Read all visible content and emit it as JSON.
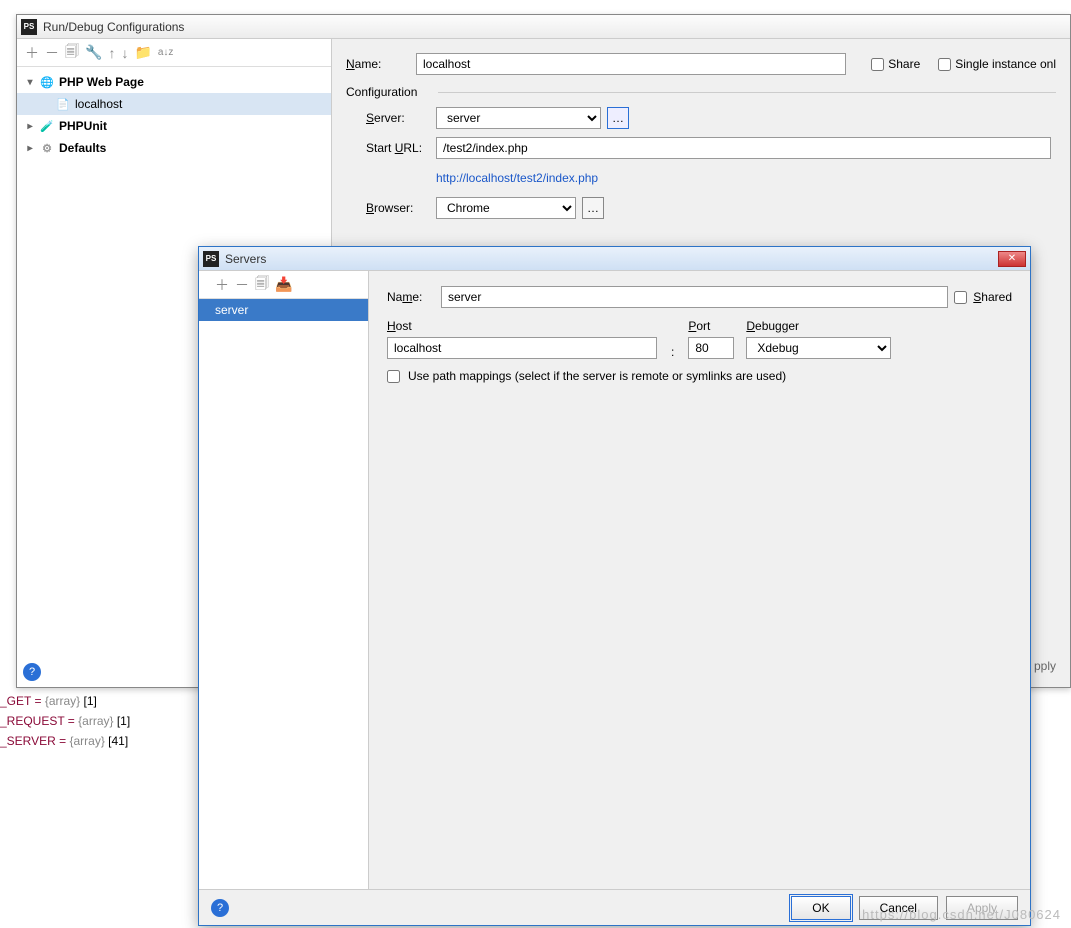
{
  "run": {
    "title": "Run/Debug Configurations",
    "name_label": "Name:",
    "name_value": "localhost",
    "share": "Share",
    "single": "Single instance onl",
    "config_group": "Configuration",
    "server_label": "Server:",
    "server_value": "server",
    "starturl_label": "Start URL:",
    "starturl_value": "/test2/index.php",
    "full_url": "http://localhost/test2/index.php",
    "browser_label": "Browser:",
    "browser_value": "Chrome",
    "tree": {
      "phpweb": "PHP Web Page",
      "localhost": "localhost",
      "phpunit": "PHPUnit",
      "defaults": "Defaults"
    },
    "apply_label": "pply"
  },
  "servers": {
    "title": "Servers",
    "name_label": "Name:",
    "name_value": "server",
    "shared": "Shared",
    "host_label": "Host",
    "host_value": "localhost",
    "port_label": "Port",
    "port_value": "80",
    "debugger_label": "Debugger",
    "debugger_value": "Xdebug",
    "pathmap": "Use path mappings (select if the server is remote or symlinks are used)",
    "list_item": "server",
    "ok": "OK",
    "cancel": "Cancel",
    "apply": "Apply"
  },
  "code": {
    "l1a": "_GET = ",
    "l1b": "{array}",
    "l1c": " [1]",
    "l2a": "_REQUEST = ",
    "l2b": "{array}",
    "l2c": " [1]",
    "l3a": "_SERVER = ",
    "l3b": "{array}",
    "l3c": " [41]"
  },
  "wm": "https://blog.csdn.net/J080624"
}
